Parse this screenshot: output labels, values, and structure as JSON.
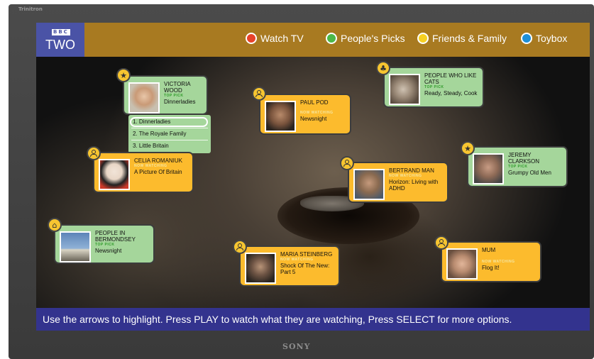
{
  "tv": {
    "brand_top": "Trinitron",
    "brand_bottom": "SONY"
  },
  "channel": {
    "logo_small": "BBC",
    "logo_big": "TWO"
  },
  "menu": [
    {
      "label": "Watch TV",
      "color": "#e8432a"
    },
    {
      "label": "People's Picks",
      "color": "#4cb848"
    },
    {
      "label": "Friends & Family",
      "color": "#f7d023"
    },
    {
      "label": "Toybox",
      "color": "#1d8fd8"
    }
  ],
  "cards": [
    {
      "name": "VICTORIA WOOD",
      "tag": "TOP PICK",
      "program": "Dinnerladies",
      "style": "green",
      "badge": "star"
    },
    {
      "name": "PAUL POD",
      "tag": "NOW WATCHING",
      "program": "Newsnight",
      "style": "orange",
      "badge": "person"
    },
    {
      "name": "PEOPLE WHO LIKE CATS",
      "tag": "TOP PICK",
      "program": "Ready, Steady, Cook",
      "style": "green",
      "badge": "cat"
    },
    {
      "name": "CELIA ROMANIUK",
      "tag": "NOW WATCHING",
      "program": "A Picture Of Britain",
      "style": "orange",
      "badge": "person"
    },
    {
      "name": "BERTRAND MAN",
      "tag": "NOW WATCHING",
      "program": "Horizon: Living with ADHD",
      "style": "orange",
      "badge": "person"
    },
    {
      "name": "JEREMY CLARKSON",
      "tag": "TOP PICK",
      "program": "Grumpy Old Men",
      "style": "green",
      "badge": "star"
    },
    {
      "name": "PEOPLE IN BERMONDSEY",
      "tag": "TOP PICK",
      "program": "Newsnight",
      "style": "green",
      "badge": "home"
    },
    {
      "name": "MARIA STEINBERG",
      "tag": "NOW WATCHING",
      "program": "Shock Of The New: Part 5",
      "style": "orange",
      "badge": "person"
    },
    {
      "name": "MUM",
      "tag": "NOW WATCHING",
      "program": "Flog It!",
      "style": "orange",
      "badge": "person"
    }
  ],
  "picks_list": [
    "1. Dinnerladies",
    "2. The Royale Family",
    "3. Little Britain"
  ],
  "instructions": "Use the arrows to highlight. Press PLAY to watch what they are watching, Press SELECT for more options."
}
